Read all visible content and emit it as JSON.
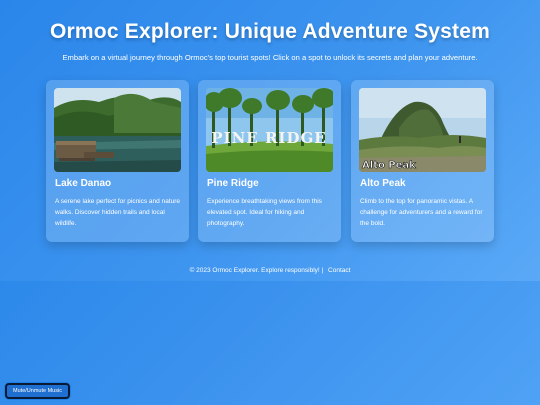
{
  "header": {
    "title": "Ormoc Explorer: Unique Adventure System",
    "subtitle": "Embark on a virtual journey through Ormoc's top tourist spots! Click on a spot to unlock its secrets and plan your adventure."
  },
  "spots": [
    {
      "name": "Lake Danao",
      "description": "A serene lake perfect for picnics and nature walks. Discover hidden trails and local wildlife."
    },
    {
      "name": "Pine Ridge",
      "description": "Experience breathtaking views from this elevated spot. Ideal for hiking and photography.",
      "image_text": "PINE RIDGE"
    },
    {
      "name": "Alto Peak",
      "description": "Climb to the top for panoramic vistas. A challenge for adventurers and a reward for the bold.",
      "image_text": "Alto Peak"
    }
  ],
  "footer": {
    "text": "© 2023 Ormoc Explorer. Explore responsibly! |",
    "contact_label": "Contact"
  },
  "audio": {
    "toggle_label": "Mute/Unmute Music"
  }
}
